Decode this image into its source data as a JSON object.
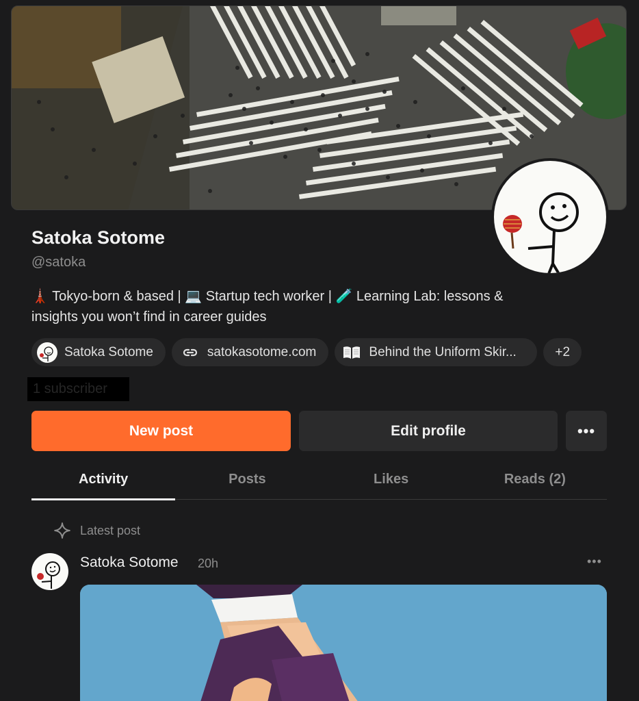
{
  "profile": {
    "name": "Satoka Sotome",
    "handle": "@satoka",
    "bio_line1": "🗼 Tokyo-born & based | 💻 Startup tech worker | 🧪 Learning Lab: lessons &",
    "bio_line2": "insights you won’t find in career guides",
    "subscribers": "1 subscriber"
  },
  "chips": [
    {
      "label": "Satoka Sotome",
      "icon": "avatar"
    },
    {
      "label": "satokasotome.com",
      "icon": "link-icon"
    },
    {
      "label": "Behind the Uniform Skir...",
      "icon": "book-icon"
    },
    {
      "label": "+2"
    }
  ],
  "actions": {
    "new_post": "New post",
    "edit_profile": "Edit profile",
    "more": "•••"
  },
  "tabs": [
    {
      "label": "Activity",
      "active": true
    },
    {
      "label": "Posts"
    },
    {
      "label": "Likes"
    },
    {
      "label": "Reads (2)"
    }
  ],
  "feed": {
    "section_label": "Latest post",
    "post": {
      "author": "Satoka Sotome",
      "time": "20h",
      "menu": "•••"
    }
  },
  "colors": {
    "background": "#1b1b1c",
    "accent": "#ff6b2c",
    "surface": "#2b2b2c"
  }
}
